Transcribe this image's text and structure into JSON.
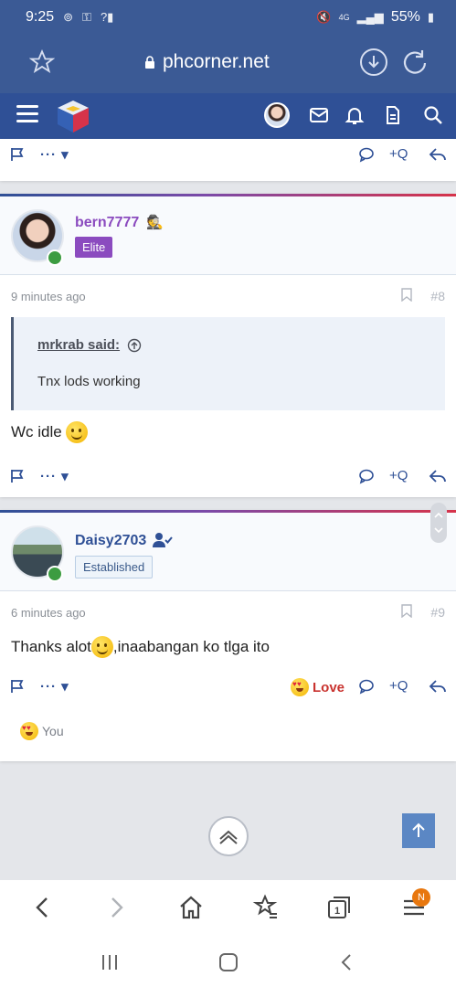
{
  "status_bar": {
    "time": "9:25",
    "battery": "55%",
    "network": "4G"
  },
  "browser": {
    "url": "phcorner.net"
  },
  "posts": [
    {
      "number": "#8",
      "username": "bern7777",
      "badge": "Elite",
      "time": "9 minutes ago",
      "quote_author": "mrkrab said:",
      "quote_text": "Tnx lods working",
      "message": "Wc idle",
      "plus_q": "+Q"
    },
    {
      "number": "#9",
      "username": "Daisy2703",
      "badge": "Established",
      "time": "6 minutes ago",
      "message_before": "Thanks alot",
      "message_after": ",inaabangan ko tlga ito",
      "reaction_label": "Love",
      "reacted_by": "You",
      "plus_q": "+Q"
    }
  ],
  "top_actions": {
    "plus_q": "+Q"
  },
  "tabs_count": "1",
  "menu_badge": "N",
  "colors": {
    "brand_blue": "#2f5096",
    "elite_badge": "#8b4bbf",
    "online": "#3c9c41",
    "love": "#c9332f"
  }
}
